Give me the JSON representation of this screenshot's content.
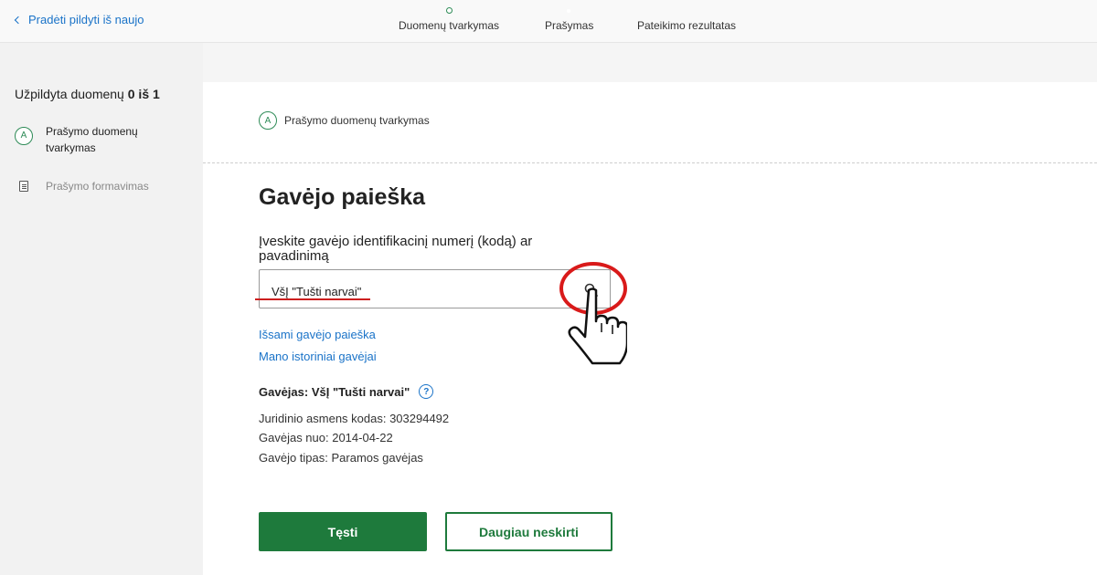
{
  "header": {
    "back_label": "Pradėti pildyti iš naujo",
    "steps": [
      "Duomenų tvarkymas",
      "Prašymas",
      "Pateikimo rezultatas"
    ]
  },
  "sidebar": {
    "progress_prefix": "Užpildyta duomenų",
    "progress_value": "0 iš 1",
    "items": [
      {
        "marker": "A",
        "label_line1": "Prašymo duomenų",
        "label_line2": "tvarkymas"
      },
      {
        "label": "Prašymo formavimas"
      }
    ]
  },
  "main": {
    "section_marker": "A",
    "section_label": "Prašymo duomenų tvarkymas",
    "title": "Gavėjo paieška",
    "field_label": "Įveskite gavėjo identifikacinį numerį (kodą) ar pavadinimą",
    "search_value": "VšĮ \"Tušti narvai\"",
    "links": {
      "detailed_search": "Išsami gavėjo paieška",
      "history": "Mano istoriniai gavėjai"
    },
    "recipient_label": "Gavėjas:",
    "recipient_name": "VšĮ \"Tušti narvai\"",
    "help_symbol": "?",
    "info": {
      "code": "Juridinio asmens kodas: 303294492",
      "since": "Gavėjas nuo: 2014-04-22",
      "type": "Gavėjo tipas: Paramos gavėjas"
    },
    "buttons": {
      "continue": "Tęsti",
      "stop": "Daugiau neskirti"
    }
  },
  "colors": {
    "accent_green": "#1e7a3c",
    "link_blue": "#1a73c8",
    "annotation_red": "#d91a1a"
  },
  "icons": [
    "chevron-left-icon",
    "circle-a-icon",
    "document-icon",
    "search-icon",
    "help-icon",
    "pointer-hand-icon"
  ]
}
